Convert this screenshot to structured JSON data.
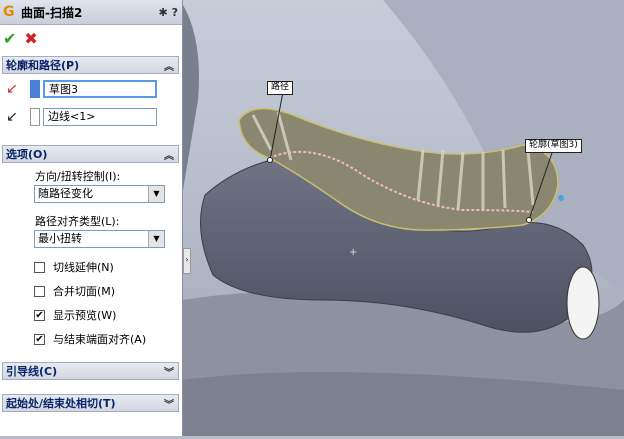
{
  "panel": {
    "title": "曲面-扫描2",
    "help": "?",
    "groups": {
      "profile_path": {
        "title": "轮廓和路径(P)",
        "profile_value": "草图3",
        "path_value": "边线<1>"
      },
      "options": {
        "title": "选项(O)",
        "orientation_label": "方向/扭转控制(I):",
        "orientation_value": "随路径变化",
        "alignment_label": "路径对齐类型(L):",
        "alignment_value": "最小扭转",
        "checks": [
          {
            "label": "切线延伸(N)",
            "checked": false
          },
          {
            "label": "合并切面(M)",
            "checked": false
          },
          {
            "label": "显示预览(W)",
            "checked": true
          },
          {
            "label": "与结束端面对齐(A)",
            "checked": true
          }
        ]
      },
      "guide": {
        "title": "引导线(C)"
      },
      "tangency": {
        "title": "起始处/结束处相切(T)"
      }
    }
  },
  "viewport": {
    "tag_path": "路径",
    "tag_profile": "轮廓(草图3)"
  },
  "colors": {
    "accent": "#0a246a",
    "body": "#5a5e6e",
    "surface": "#8a8770"
  }
}
